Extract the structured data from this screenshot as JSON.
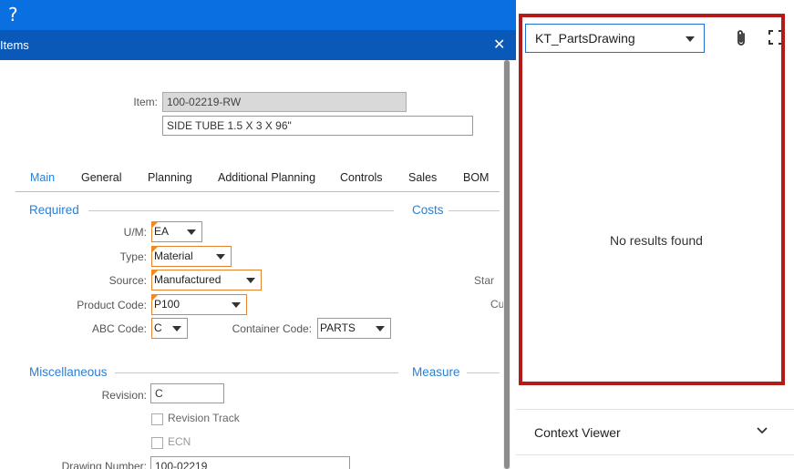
{
  "header": {
    "help_icon": "?",
    "form_title": "Items",
    "close_glyph": "✕"
  },
  "item": {
    "label": "Item:",
    "id": "100-02219-RW",
    "description": "SIDE TUBE 1.5 X 3 X 96\""
  },
  "tabs": [
    "Main",
    "General",
    "Planning",
    "Additional Planning",
    "Controls",
    "Sales",
    "BOM"
  ],
  "sections": {
    "required": "Required",
    "costs": "Costs",
    "misc": "Miscellaneous",
    "measure": "Measure"
  },
  "fields": {
    "um_label": "U/M:",
    "um_value": "EA",
    "type_label": "Type:",
    "type_value": "Material",
    "source_label": "Source:",
    "source_value": "Manufactured",
    "product_code_label": "Product Code:",
    "product_code_value": "P100",
    "abc_label": "ABC Code:",
    "abc_value": "C",
    "container_label": "Container Code:",
    "container_value": "PARTS",
    "revision_label": "Revision:",
    "revision_value": "C",
    "revision_track_label": "Revision Track",
    "ecn_label": "ECN",
    "drawing_label": "Drawing Number:",
    "drawing_value": "100-02219",
    "cut_star": "Star",
    "cut_c": "Cu"
  },
  "right_panel": {
    "dropdown_value": "KT_PartsDrawing",
    "empty_message": "No results found",
    "context_viewer": "Context Viewer"
  },
  "colors": {
    "topbar": "#0a6fe0",
    "formhead": "#0a58b8",
    "accent": "#2a7fd4",
    "highlight": "#b31b1b",
    "required_flag": "#f08a24"
  }
}
